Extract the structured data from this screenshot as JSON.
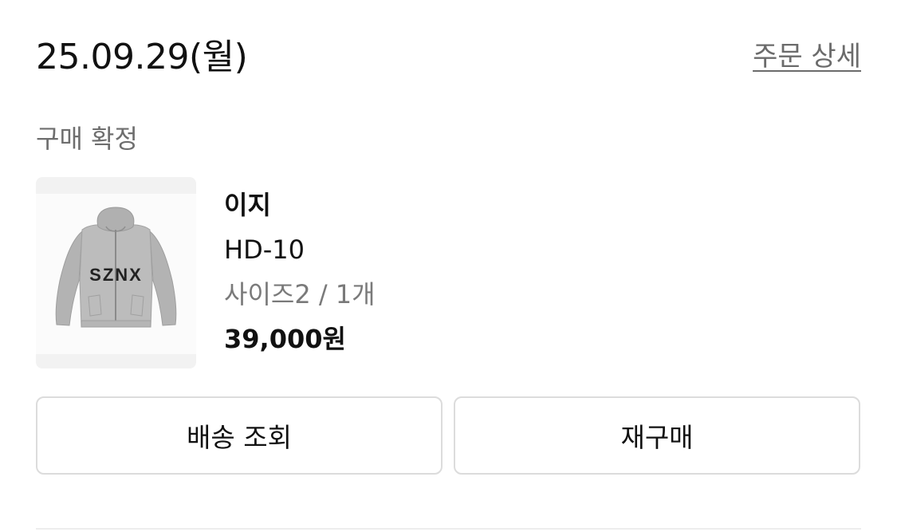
{
  "order": {
    "date": "25.09.29(월)",
    "detail_link": "주문 상세",
    "status": "구매 확정"
  },
  "product": {
    "image_label": "SZNX",
    "brand": "이지",
    "name": "HD-10",
    "option": "사이즈2 / 1개",
    "price": "39,000원"
  },
  "actions": {
    "tracking_label": "배송 조회",
    "reorder_label": "재구매"
  },
  "colors": {
    "text_primary": "#111111",
    "text_secondary": "#6e6e6e",
    "border": "#dcdcdc",
    "hoodie_gray": "#b3b3b3"
  },
  "icons": {
    "product_image": "gray-zip-hoodie-image"
  }
}
